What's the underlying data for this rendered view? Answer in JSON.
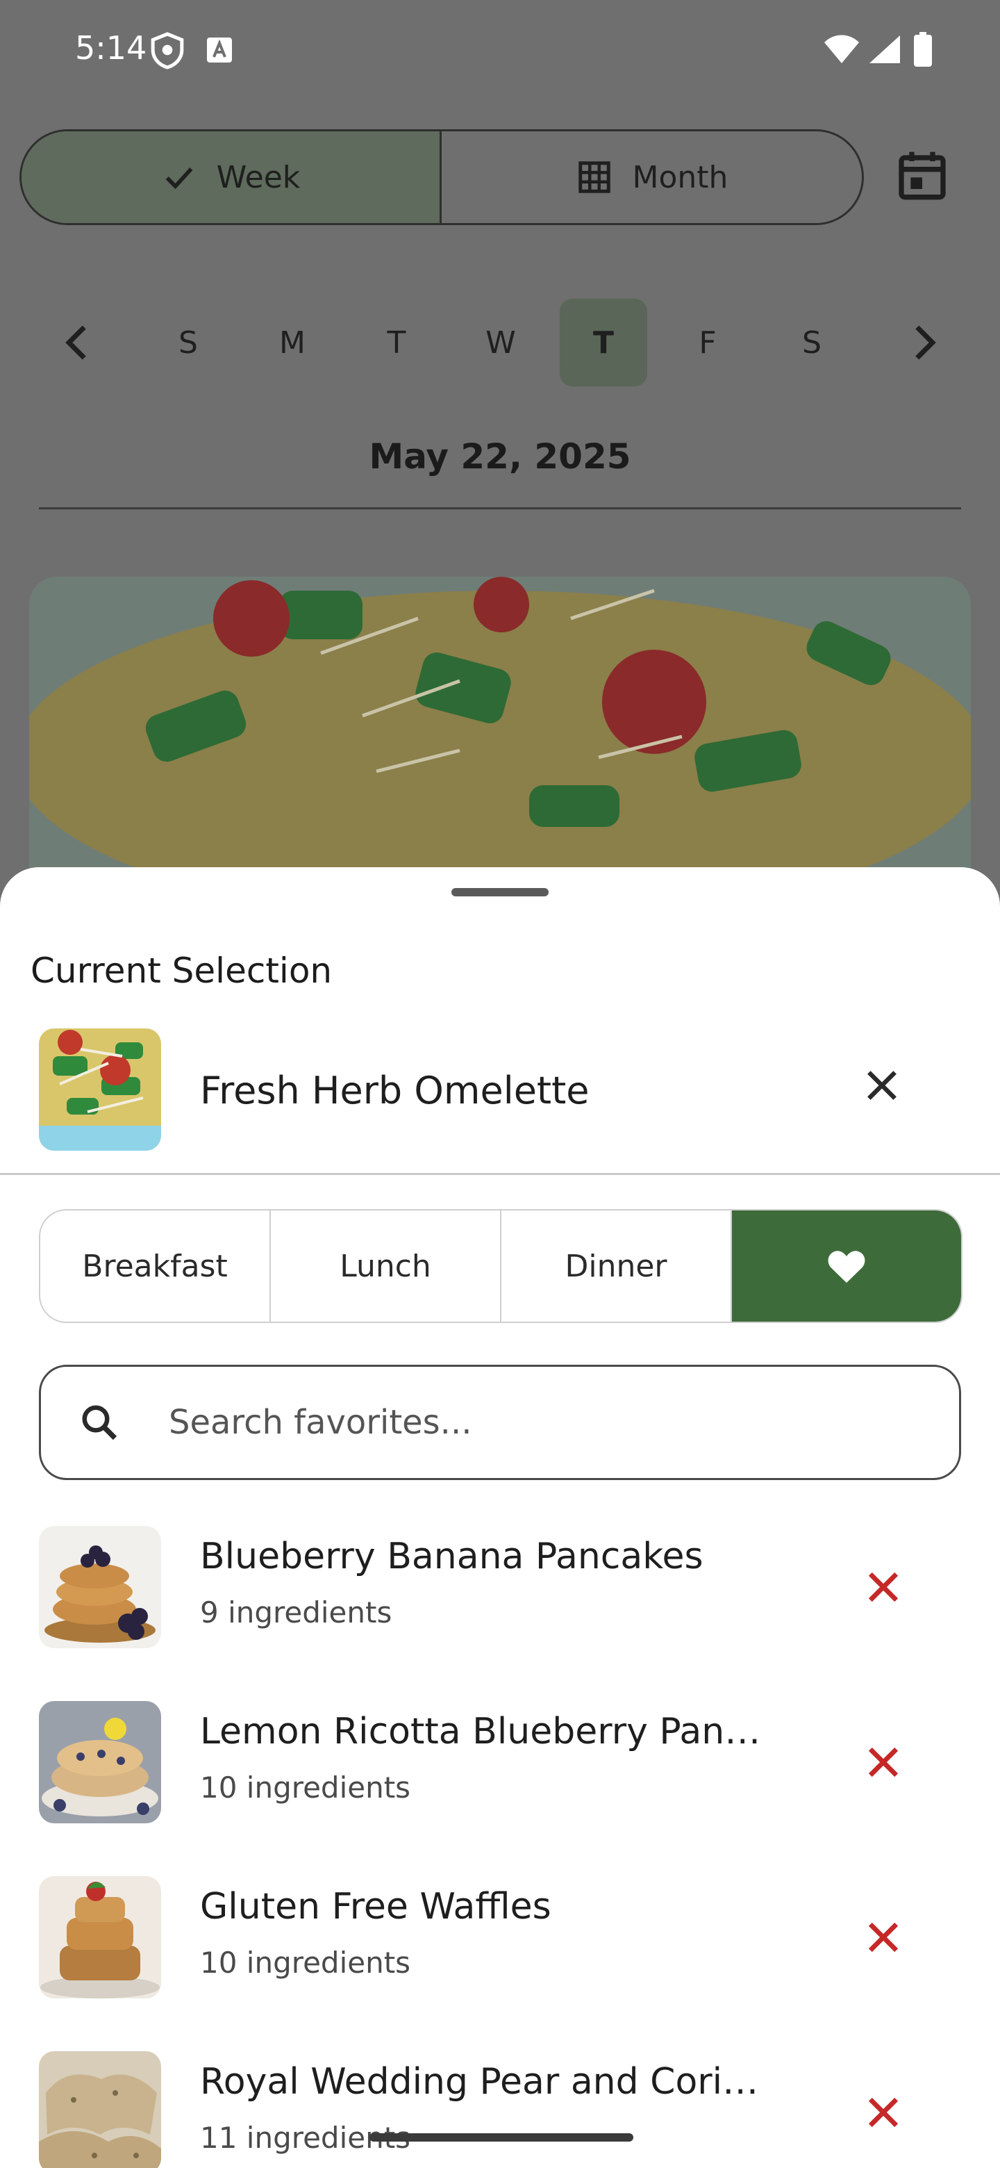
{
  "status_bar": {
    "time": "5:14",
    "icons": [
      "shield-icon",
      "keyboard-a-icon",
      "wifi-icon",
      "cell-signal-icon",
      "battery-icon"
    ]
  },
  "view_toggle": {
    "week_label": "Week",
    "month_label": "Month",
    "selected": "Week"
  },
  "week_strip": {
    "days": [
      "S",
      "M",
      "T",
      "W",
      "T",
      "F",
      "S"
    ],
    "selected_index": 4
  },
  "date_title": "May 22, 2025",
  "sheet": {
    "current_title": "Current Selection",
    "current_recipe": "Fresh Herb Omelette",
    "tabs": {
      "breakfast": "Breakfast",
      "lunch": "Lunch",
      "dinner": "Dinner",
      "active": "favorites"
    },
    "search": {
      "placeholder": "Search favorites..."
    },
    "recipes": [
      {
        "name": "Blueberry Banana Pancakes",
        "count": "9 ingredients"
      },
      {
        "name": "Lemon Ricotta Blueberry Pancakes",
        "count": "10 ingredients"
      },
      {
        "name": "Gluten Free Waffles",
        "count": "10 ingredients"
      },
      {
        "name": "Royal Wedding Pear and Coriander Scones",
        "count": "11 ingredients"
      }
    ]
  },
  "colors": {
    "accent_green": "#3e6b3a",
    "delete_red": "#c62828",
    "scrim": "#6f6f6f"
  }
}
